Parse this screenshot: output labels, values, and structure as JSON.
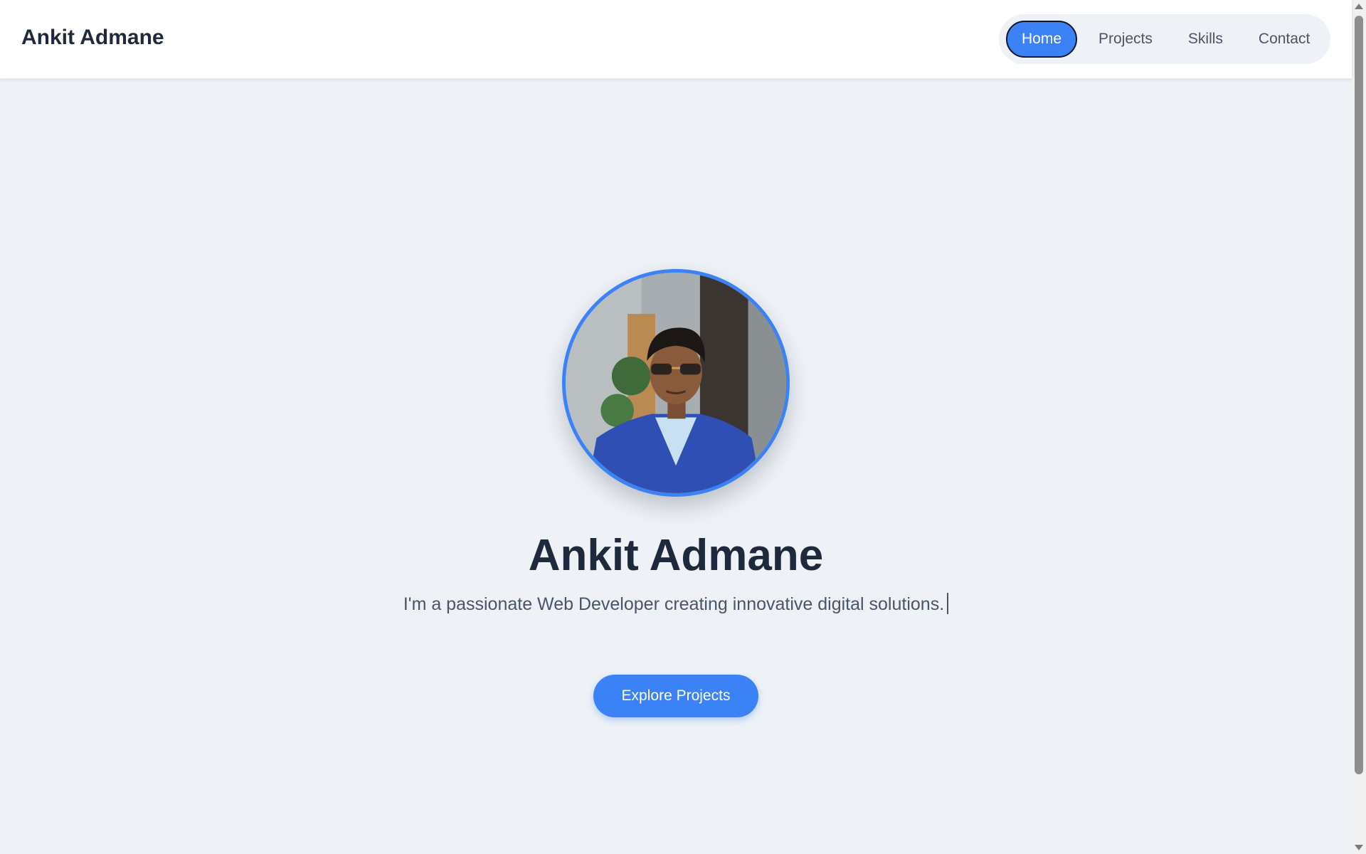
{
  "header": {
    "brand": "Ankit Admane",
    "nav": [
      {
        "label": "Home",
        "active": true
      },
      {
        "label": "Projects",
        "active": false
      },
      {
        "label": "Skills",
        "active": false
      },
      {
        "label": "Contact",
        "active": false
      }
    ]
  },
  "hero": {
    "title": "Ankit Admane",
    "subtitle": "I'm a passionate Web Developer creating innovative digital solutions.",
    "cta_label": "Explore Projects",
    "avatar_alt": "Profile photo of Ankit Admane"
  },
  "colors": {
    "accent": "#3b82f6",
    "background": "#eef2f7",
    "heading": "#1e293b",
    "body_text": "#475569"
  }
}
